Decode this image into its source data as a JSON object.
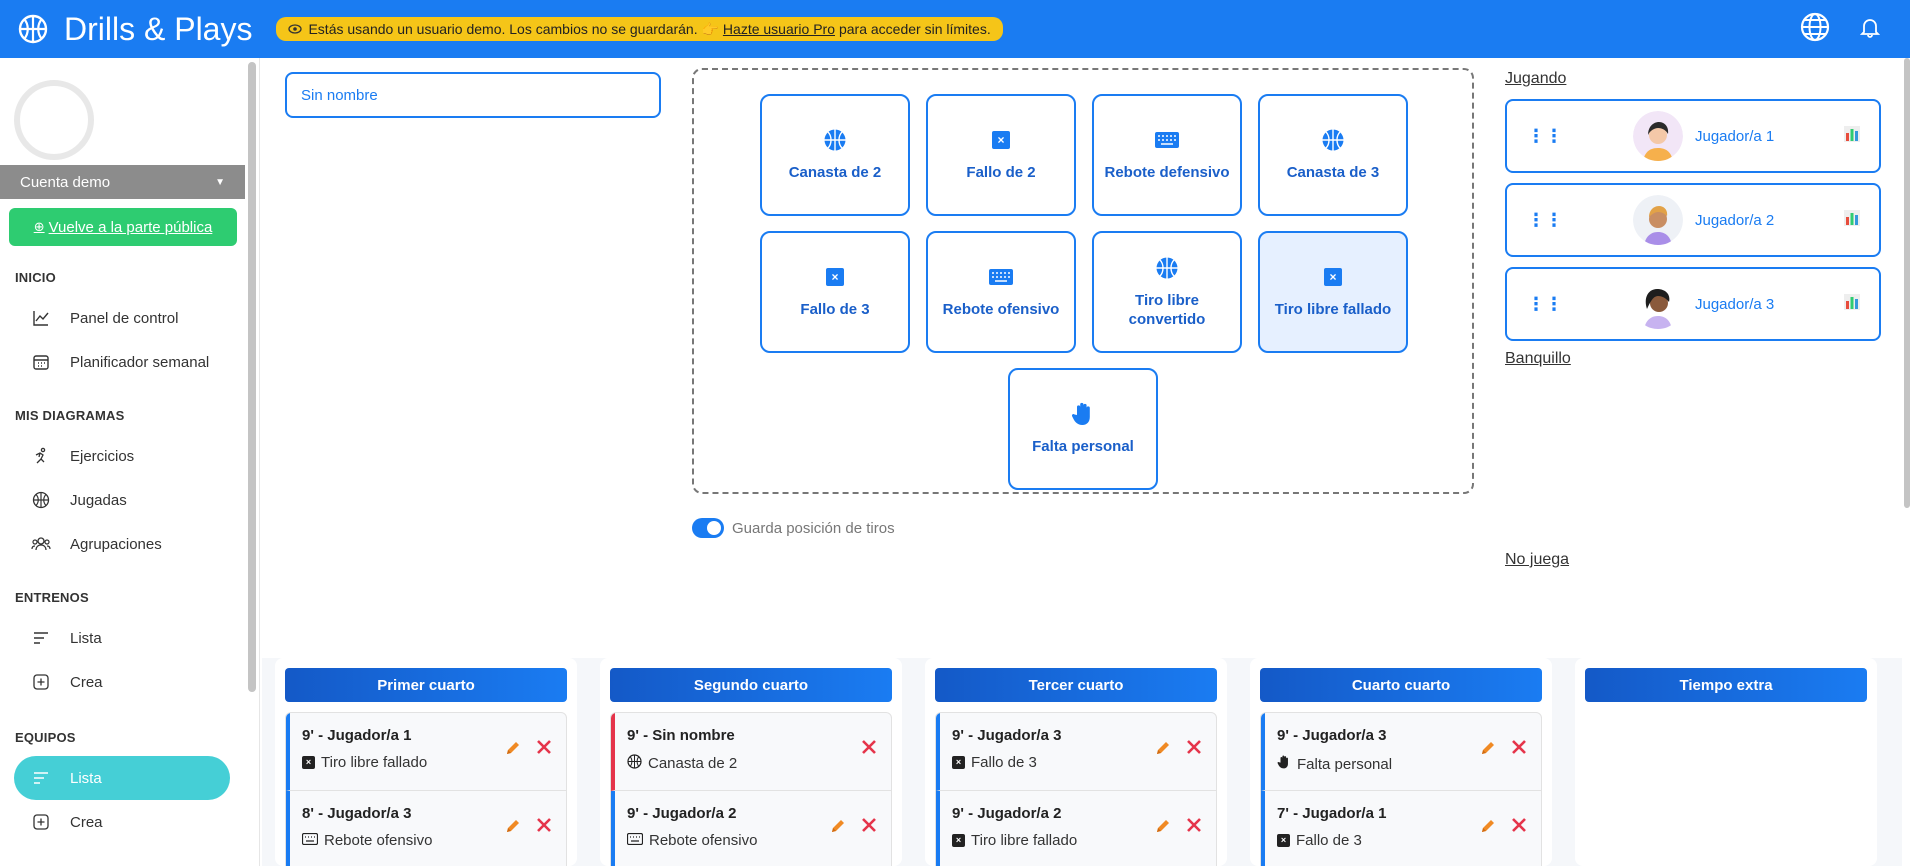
{
  "app": {
    "title": "Drills & Plays"
  },
  "banner": {
    "text_before": "Estás usando un usuario demo. Los cambios no se guardarán. 👉",
    "link": "Hazte usuario Pro",
    "text_after": "para acceder sin límites."
  },
  "sidebar": {
    "account": "Cuenta demo",
    "public_button": "Vuelve a la parte pública",
    "sections": {
      "inicio": "INICIO",
      "diagramas": "MIS DIAGRAMAS",
      "entrenos": "ENTRENOS",
      "equipos": "EQUIPOS"
    },
    "items": {
      "panel": "Panel de control",
      "planificador": "Planificador semanal",
      "ejercicios": "Ejercicios",
      "jugadas": "Jugadas",
      "agrupaciones": "Agrupaciones",
      "entrenos_lista": "Lista",
      "entrenos_crea": "Crea",
      "equipos_lista": "Lista",
      "equipos_crea": "Crea"
    }
  },
  "main": {
    "name_value": "Sin nombre",
    "actions": {
      "canasta2": "Canasta de 2",
      "fallo2": "Fallo de 2",
      "rebote_def": "Rebote defensivo",
      "canasta3": "Canasta de 3",
      "fallo3": "Fallo de 3",
      "rebote_of": "Rebote ofensivo",
      "tl_conv": "Tiro libre convertido",
      "tl_fallado": "Tiro libre fallado",
      "falta": "Falta personal"
    },
    "toggle_label": "Guarda posición de tiros"
  },
  "roster": {
    "jugando": "Jugando",
    "banquillo": "Banquillo",
    "no_juega": "No juega",
    "players": [
      "Jugador/a 1",
      "Jugador/a 2",
      "Jugador/a 3"
    ]
  },
  "quarters": {
    "q1": {
      "title": "Primer cuarto",
      "events": [
        {
          "title": "9' - Jugador/a 1",
          "desc": "Tiro libre fallado"
        },
        {
          "title": "8' - Jugador/a 3",
          "desc": "Rebote ofensivo"
        }
      ]
    },
    "q2": {
      "title": "Segundo cuarto",
      "events": [
        {
          "title": "9' - Sin nombre",
          "desc": "Canasta de 2"
        },
        {
          "title": "9' - Jugador/a 2",
          "desc": "Rebote ofensivo"
        }
      ]
    },
    "q3": {
      "title": "Tercer cuarto",
      "events": [
        {
          "title": "9' - Jugador/a 3",
          "desc": "Fallo de 3"
        },
        {
          "title": "9' - Jugador/a 2",
          "desc": "Tiro libre fallado"
        }
      ]
    },
    "q4": {
      "title": "Cuarto cuarto",
      "events": [
        {
          "title": "9' - Jugador/a 3",
          "desc": "Falta personal"
        },
        {
          "title": "7' - Jugador/a 1",
          "desc": "Fallo de 3"
        }
      ]
    },
    "extra": {
      "title": "Tiempo extra"
    }
  },
  "colors": {
    "primary": "#1a7cf2",
    "banner": "#f5c518",
    "public_button": "#2ecc71",
    "active_nav": "#45cfd6",
    "edit": "#f08a24",
    "delete": "#e5344a"
  }
}
